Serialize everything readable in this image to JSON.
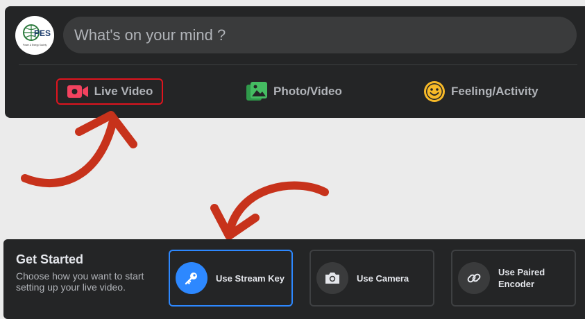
{
  "composer": {
    "avatar_logo_text": "PES",
    "avatar_logo_subtext": "Power & Energy Society",
    "placeholder": "What's on your mind ?",
    "actions": [
      {
        "label": "Live Video",
        "icon": "video-camera-icon",
        "color": "#f3425f"
      },
      {
        "label": "Photo/Video",
        "icon": "photo-icon",
        "color": "#45bd62"
      },
      {
        "label": "Feeling/Activity",
        "icon": "smiley-icon",
        "color": "#f7b928"
      }
    ]
  },
  "get_started": {
    "title": "Get Started",
    "description": "Choose how you want to start setting up your live video.",
    "options": [
      {
        "label": "Use Stream Key",
        "icon": "key-icon",
        "selected": true
      },
      {
        "label": "Use Camera",
        "icon": "camera-icon",
        "selected": false
      },
      {
        "label": "Use Paired Encoder",
        "icon": "link-icon",
        "selected": false
      }
    ]
  },
  "colors": {
    "card_bg": "#242526",
    "highlight_red": "#e0141e",
    "arrow_red": "#c7321b",
    "accent_blue": "#2d88ff"
  }
}
